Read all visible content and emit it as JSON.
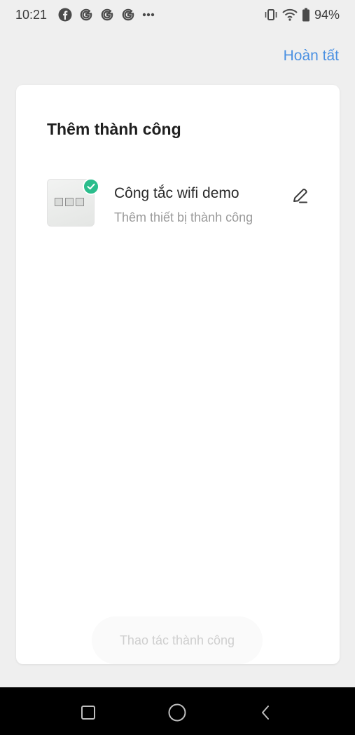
{
  "status_bar": {
    "time": "10:21",
    "notification_icons": [
      "facebook-icon",
      "google-icon",
      "google-icon",
      "google-icon",
      "more-dots-icon"
    ],
    "battery_percent": "94%"
  },
  "header": {
    "done_label": "Hoàn tất"
  },
  "card": {
    "title": "Thêm thành công",
    "device": {
      "name": "Công tắc wifi demo",
      "status": "Thêm thiết bị thành công",
      "icon": "wifi-switch-thumbnail"
    },
    "action_button_label": "Thao tác thành công"
  },
  "nav_bar": {
    "buttons": [
      "recent-apps",
      "home",
      "back"
    ]
  },
  "colors": {
    "accent": "#4a90e2",
    "success": "#2bbd8c",
    "background": "#efefef"
  }
}
